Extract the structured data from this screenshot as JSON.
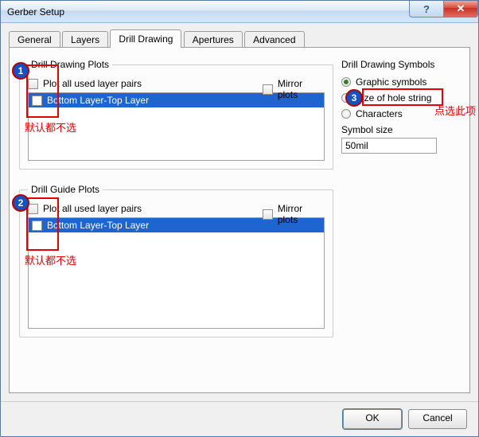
{
  "window": {
    "title": "Gerber Setup"
  },
  "tabs": [
    "General",
    "Layers",
    "Drill Drawing",
    "Apertures",
    "Advanced"
  ],
  "active_tab": "Drill Drawing",
  "drill_drawing": {
    "legend": "Drill Drawing Plots",
    "plot_all_label": "Plot all used layer pairs",
    "mirror_label": "Mirror plots",
    "list_item": "Bottom Layer-Top Layer",
    "symbols_legend": "Drill Drawing Symbols",
    "radio_graphic": "Graphic symbols",
    "radio_hole": "Size of hole string",
    "radio_chars": "Characters",
    "symbol_size_label": "Symbol size",
    "symbol_size_value": "50mil"
  },
  "drill_guide": {
    "legend": "Drill Guide Plots",
    "plot_all_label": "Plot all used layer pairs",
    "mirror_label": "Mirror plots",
    "list_item": "Bottom Layer-Top Layer"
  },
  "buttons": {
    "ok": "OK",
    "cancel": "Cancel"
  },
  "annotations": {
    "b1": "1",
    "b2": "2",
    "b3": "3",
    "note_default": "默认都不选",
    "note_click": "点选此项"
  }
}
